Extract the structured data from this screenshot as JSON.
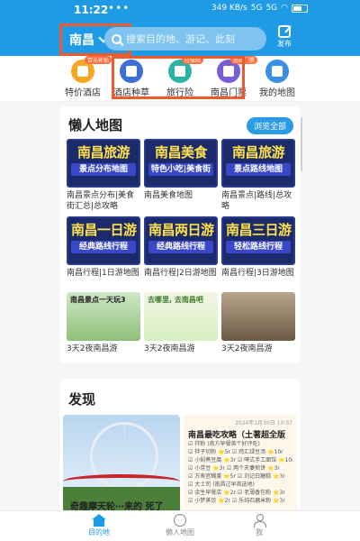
{
  "status_bar": {
    "time": "11:22",
    "dots": "•••",
    "network": "349 KB/s",
    "signal1": "5G",
    "signal2": "5G",
    "battery": ""
  },
  "header": {
    "city": "南昌",
    "search_placeholder": "搜索目的地、游记、此刻",
    "publish_label": "发布"
  },
  "quick_icons": [
    {
      "label": "特价酒店",
      "badge": "百元补贴",
      "color": "#f6a623",
      "icon": "hotel-icon"
    },
    {
      "label": "酒店种草",
      "badge": "",
      "color": "#3b6fd8",
      "icon": "building-icon"
    },
    {
      "label": "旅行险",
      "badge": "轻保险",
      "color": "#29b5a6",
      "icon": "shield-icon"
    },
    {
      "label": "南昌门票",
      "badge": "南昌门票",
      "color": "#7a5cd6",
      "icon": "ticket-icon"
    },
    {
      "label": "我的地图",
      "badge": "",
      "color": "#3a8ee6",
      "icon": "map-pin-icon"
    }
  ],
  "lazy_map": {
    "title": "懒人地图",
    "button_label": "浏览全部",
    "items": [
      {
        "line1": "南昌旅游",
        "line2": "景点分布地图",
        "caption": "南昌景点分布|美食街汇总|总攻略"
      },
      {
        "line1": "南昌美食",
        "line2": "特色小吃|美食街",
        "caption": "南昌美食地图"
      },
      {
        "line1": "南昌旅游",
        "line2": "景点路线地图",
        "caption": "南昌景点|路线|总攻略"
      },
      {
        "line1": "南昌一日游",
        "line2": "经典路线行程",
        "caption": "南昌行程|1日游地图"
      },
      {
        "line1": "南昌两日游",
        "line2": "经典路线行程",
        "caption": "南昌行程|2日游地图"
      },
      {
        "line1": "南昌三日游",
        "line2": "轻松路线行程",
        "caption": "南昌行程|3日游地图"
      },
      {
        "photo_text": "南昌景点一天玩3",
        "caption": "3天2夜南昌游"
      },
      {
        "photo_text": "去哪里, 去南昌吧",
        "caption": "3天2夜南昌游"
      },
      {
        "photo_text": "",
        "caption": "3天2夜南昌游"
      }
    ]
  },
  "discover": {
    "title": "发现",
    "photo_caption": "奇趣摩天轮⋯来的    死了",
    "note": {
      "date": "2024年1月30日 10:37",
      "title": "南昌最吃攻略（土著超全版",
      "lines": [
        "☑ 拌粉   (南方早餐首个好评吃)",
        "☑ 拌子切粉 ⭐5r     ☑ 鸡汇绿豆汤 ⭐10r",
        "☑ 小焖煮豆腐 ⭐3r   ☑ 啤式手工面馆 ⭐10r",
        "☑ 小芽豆 ⭐3r       ☑ 两个夫妻煎饼 ⭐3r",
        "☑ 万寿宫糊羹 ⭐5r   ☑ 刘记白糖糕 ⭐3r",
        "☑ 大土司 (南昌过早首选地)",
        "☑ 余生早餐店 ⭐2r   ☑ 老薄香包粉 ⭐3r",
        "☑ 小梦蒸饺 ⭐2r     ☑ 乐纯石磨米粉 ⭐3r"
      ]
    }
  },
  "bottom_nav": [
    {
      "label": "目的地",
      "active": true
    },
    {
      "label": "懒人地图",
      "active": false
    },
    {
      "label": "我",
      "active": false
    }
  ],
  "colors": {
    "primary": "#1f9be6",
    "highlight_border": "#ee5a2f",
    "map_card_bg": "#1a2a6b",
    "map_title": "#ffe14a"
  }
}
